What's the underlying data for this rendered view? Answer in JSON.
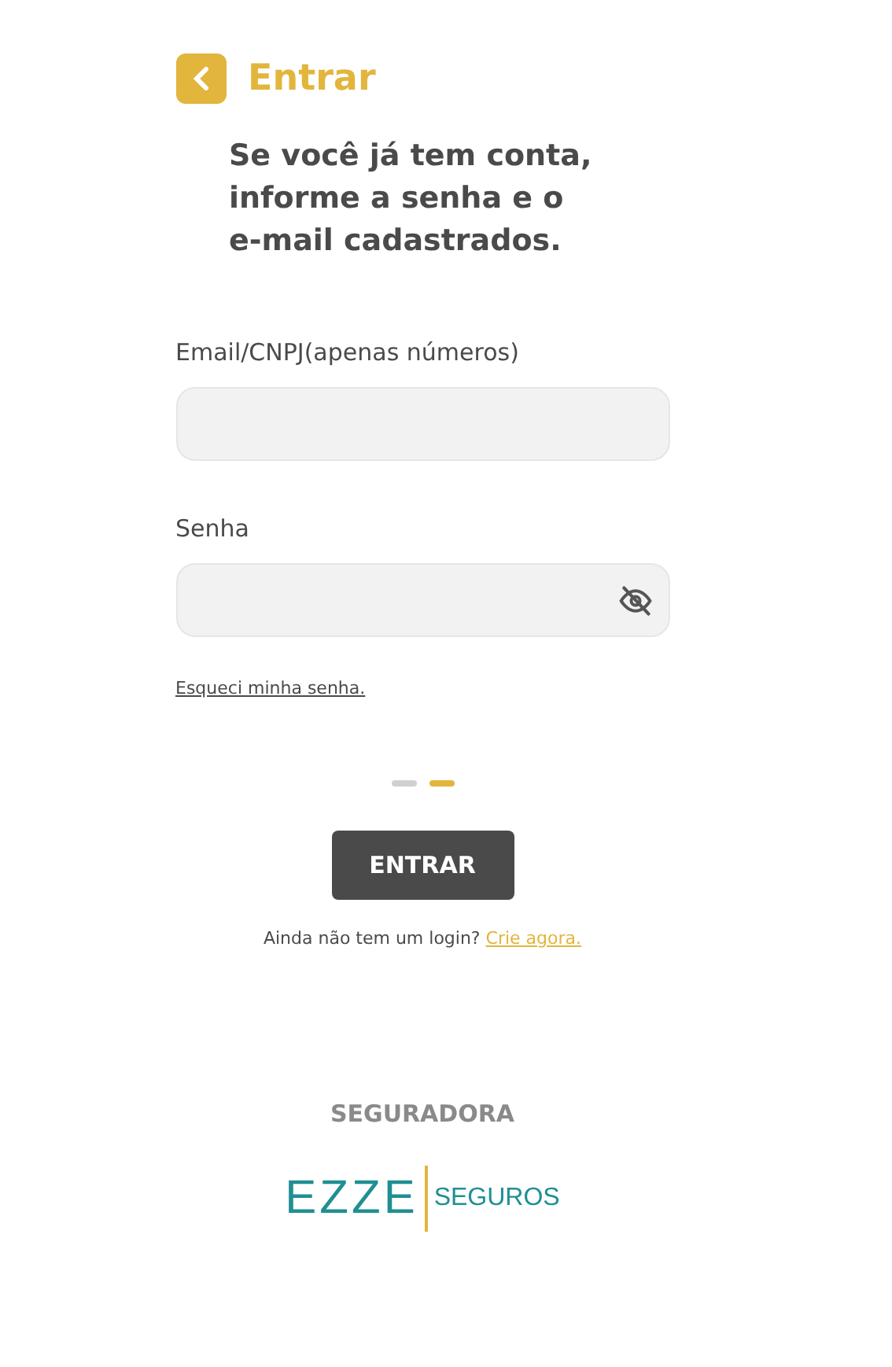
{
  "header": {
    "title": "Entrar"
  },
  "intro": "Se você já tem conta, informe a senha e o e-mail cadastrados.",
  "fields": [
    {
      "label": "Email/CNPJ(apenas números)",
      "kind": "text"
    },
    {
      "label": "Senha",
      "kind": "password"
    }
  ],
  "forgot_link": "Esqueci minha senha.",
  "steps": [
    {
      "selected": false
    },
    {
      "selected": true
    }
  ],
  "submit": "ENTRAR",
  "signup": {
    "text": "Ainda não tem um login?",
    "link": "Crie agora."
  },
  "insurer": {
    "heading": "SEGURADORA",
    "logo_main": "EZZE",
    "logo_sub": "SEGUROS"
  }
}
